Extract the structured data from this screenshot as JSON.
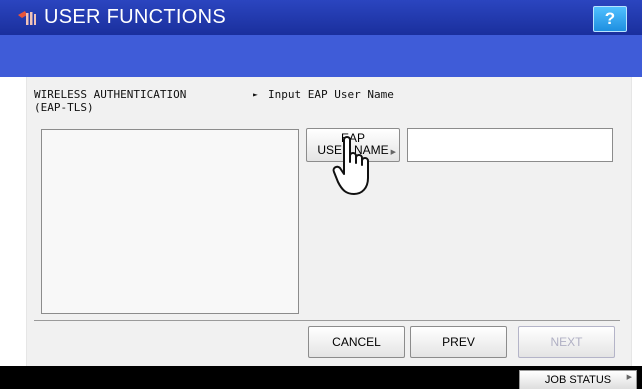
{
  "header": {
    "title": "USER FUNCTIONS",
    "help_label": "?",
    "app_icon": "tools-icon"
  },
  "panel": {
    "section_title": "WIRELESS AUTHENTICATION\n(EAP-TLS)",
    "step_indicator": "►",
    "step_label": "Input EAP User Name"
  },
  "form": {
    "eap_button_line1": "EAP",
    "eap_button_line2": "USER NAME",
    "eap_user_name_value": ""
  },
  "buttons": {
    "cancel": "CANCEL",
    "prev": "PREV",
    "next": "NEXT",
    "next_enabled": false
  },
  "footer": {
    "job_status": "JOB STATUS"
  },
  "colors": {
    "title_bar": "#2b45c0",
    "sub_bar": "#3f5cd8",
    "help_button": "#1e8fe0",
    "content_bg": "#f1f1f1",
    "footer": "#000000"
  }
}
